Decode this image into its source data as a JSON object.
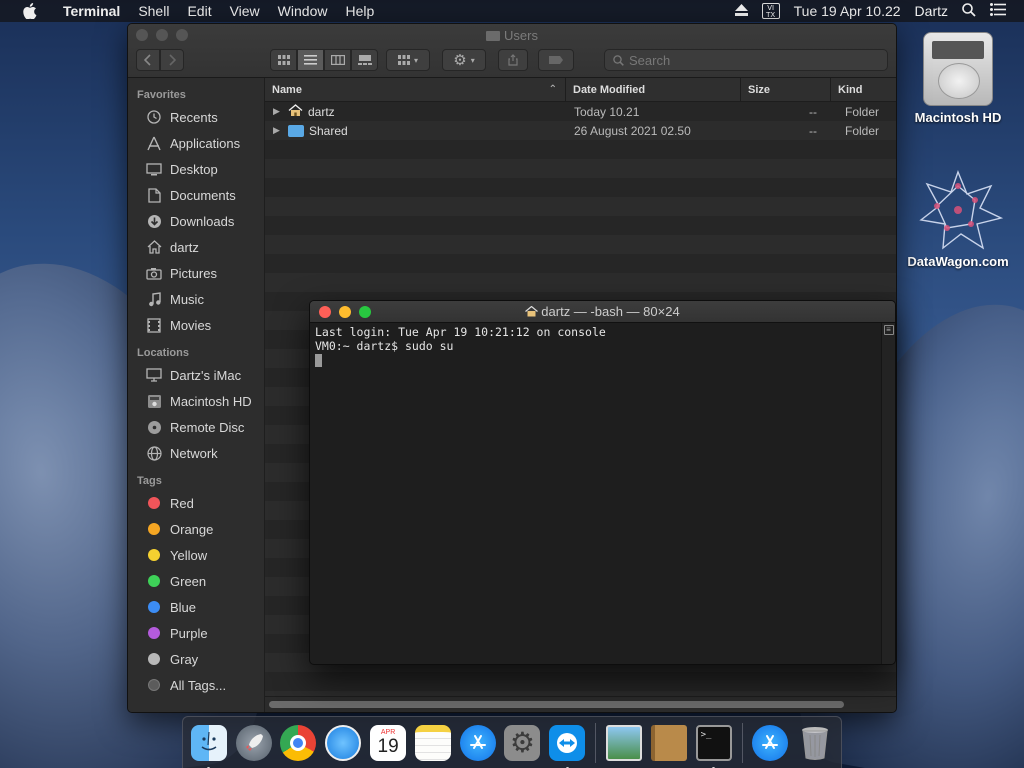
{
  "menubar": {
    "app_name": "Terminal",
    "items": [
      "Shell",
      "Edit",
      "View",
      "Window",
      "Help"
    ],
    "input_source": "VI TX",
    "datetime": "Tue 19 Apr  10.22",
    "user": "Dartz"
  },
  "desktop": {
    "icons": [
      {
        "label": "Macintosh HD",
        "icon": "hard-drive-icon"
      },
      {
        "label": "DataWagon.com",
        "icon": "datawagon-logo-icon"
      }
    ]
  },
  "finder": {
    "title": "Users",
    "search_placeholder": "Search",
    "sidebar": {
      "favorites_header": "Favorites",
      "favorites": [
        "Recents",
        "Applications",
        "Desktop",
        "Documents",
        "Downloads",
        "dartz",
        "Pictures",
        "Music",
        "Movies"
      ],
      "locations_header": "Locations",
      "locations": [
        "Dartz's iMac",
        "Macintosh HD",
        "Remote Disc",
        "Network"
      ],
      "tags_header": "Tags",
      "tags": [
        {
          "label": "Red",
          "color": "#f0555a"
        },
        {
          "label": "Orange",
          "color": "#f5a623"
        },
        {
          "label": "Yellow",
          "color": "#f5d130"
        },
        {
          "label": "Green",
          "color": "#3ed158"
        },
        {
          "label": "Blue",
          "color": "#3c8df5"
        },
        {
          "label": "Purple",
          "color": "#b45bdc"
        },
        {
          "label": "Gray",
          "color": "#b8b8b8"
        }
      ],
      "all_tags": "All Tags..."
    },
    "columns": {
      "name": "Name",
      "date": "Date Modified",
      "size": "Size",
      "kind": "Kind"
    },
    "rows": [
      {
        "name": "dartz",
        "icon": "home-folder-icon",
        "date": "Today 10.21",
        "size": "--",
        "kind": "Folder"
      },
      {
        "name": "Shared",
        "icon": "folder-icon",
        "date": "26 August 2021 02.50",
        "size": "--",
        "kind": "Folder"
      }
    ]
  },
  "terminal": {
    "title": "dartz — -bash — 80×24",
    "lines": [
      "Last login: Tue Apr 19 10:21:12 on console",
      "VM0:~ dartz$ sudo su"
    ]
  },
  "dock": {
    "apps": [
      "Finder",
      "Launchpad",
      "Google Chrome",
      "Safari",
      "Calendar",
      "Notes",
      "App Store",
      "System Preferences",
      "TeamViewer",
      "Preview",
      "Notes Folder",
      "Terminal",
      "Applications",
      "Trash"
    ],
    "calendar_month": "APR",
    "calendar_day": "19"
  }
}
